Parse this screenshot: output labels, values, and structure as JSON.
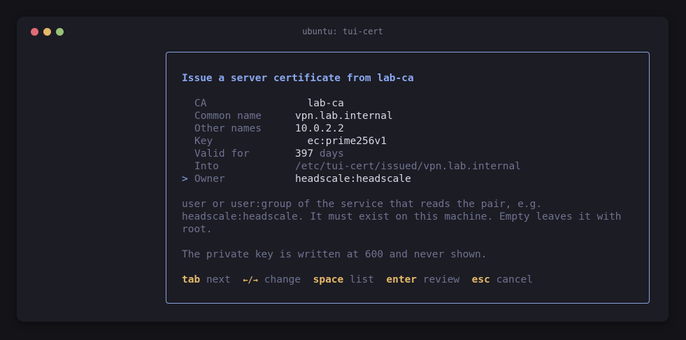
{
  "window": {
    "title": "ubuntu: tui-cert"
  },
  "form": {
    "heading": "Issue a server certificate from lab-ca",
    "fields": [
      {
        "label": "CA",
        "value": "  lab-ca"
      },
      {
        "label": "Common name",
        "value": "vpn.lab.internal"
      },
      {
        "label": "Other names",
        "value": "10.0.2.2"
      },
      {
        "label": "Key",
        "value": "  ec:prime256v1"
      },
      {
        "label": "Valid for",
        "value": "397",
        "unit": " days"
      },
      {
        "label": "Into",
        "value": "/etc/tui-cert/issued/vpn.lab.internal"
      },
      {
        "label": "Owner",
        "value": "headscale:headscale",
        "cursor": "> "
      }
    ],
    "help_lines": [
      "user or user:group of the service that reads the pair, e.g.",
      "headscale:headscale. It must exist on this machine. Empty leaves it with",
      "root."
    ],
    "note": "The private key is written at 600 and never shown."
  },
  "keys": [
    {
      "key": "tab",
      "desc": "next"
    },
    {
      "key": "←/→",
      "desc": "change"
    },
    {
      "key": "space",
      "desc": "list"
    },
    {
      "key": "enter",
      "desc": "review"
    },
    {
      "key": "esc",
      "desc": "cancel"
    }
  ],
  "colors": {
    "accent": "#8aa8f0",
    "key": "#e5b96a",
    "muted": "#6e7390",
    "text": "#d6d8e2",
    "border": "#8aa1e0"
  }
}
